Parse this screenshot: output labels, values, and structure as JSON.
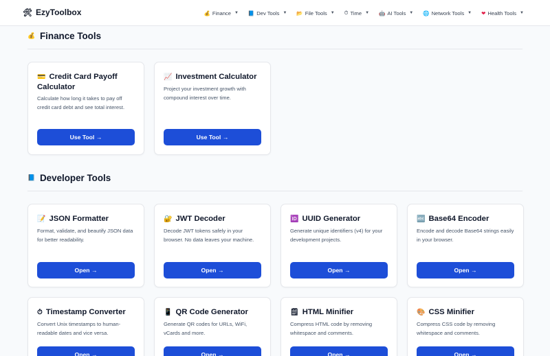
{
  "header": {
    "logo_icon": "tools-icon",
    "brand": "EzyToolbox",
    "nav": [
      {
        "icon": "💰",
        "label": "Finance"
      },
      {
        "icon": "📘",
        "label": "Dev Tools"
      },
      {
        "icon": "📂",
        "label": "File Tools"
      },
      {
        "icon": "⏱",
        "label": "Time"
      },
      {
        "icon": "🤖",
        "label": "AI Tools"
      },
      {
        "icon": "🌐",
        "label": "Network Tools"
      },
      {
        "icon": "❤",
        "label": "Health Tools"
      }
    ]
  },
  "finance": {
    "icon": "💰",
    "title": "Finance Tools",
    "cards": [
      {
        "icon": "💳",
        "title": "Credit Card Payoff Calculator",
        "desc": "Calculate how long it takes to pay off credit card debt and see total interest.",
        "button": "Use Tool →"
      },
      {
        "icon": "📈",
        "title": "Investment Calculator",
        "desc": "Project your investment growth with compound interest over time.",
        "button": "Use Tool →"
      }
    ]
  },
  "developer": {
    "icon": "📘",
    "title": "Developer Tools",
    "cards": [
      {
        "icon": "📝",
        "title": "JSON Formatter",
        "desc": "Format, validate, and beautify JSON data for better readability.",
        "button": "Open →"
      },
      {
        "icon": "🔐",
        "title": "JWT Decoder",
        "desc": "Decode JWT tokens safely in your browser. No data leaves your machine.",
        "button": "Open →"
      },
      {
        "icon": "🆔",
        "title": "UUID Generator",
        "desc": "Generate unique identifiers (v4) for your development projects.",
        "button": "Open →"
      },
      {
        "icon": "🔤",
        "title": "Base64 Encoder",
        "desc": "Encode and decode Base64 strings easily in your browser.",
        "button": "Open →"
      },
      {
        "icon": "⏱",
        "title": "Timestamp Converter",
        "desc": "Convert Unix timestamps to human-readable dates and vice versa.",
        "button": "Open →"
      },
      {
        "icon": "📱",
        "title": "QR Code Generator",
        "desc": "Generate QR codes for URLs, WiFi, vCards and more.",
        "button": "Open →"
      },
      {
        "icon": "🗒",
        "title": "HTML Minifier",
        "desc": "Compress HTML code by removing whitespace and comments.",
        "button": "Open →"
      },
      {
        "icon": "🎨",
        "title": "CSS Minifier",
        "desc": "Compress CSS code by removing whitespace and comments.",
        "button": "Open →"
      }
    ]
  }
}
